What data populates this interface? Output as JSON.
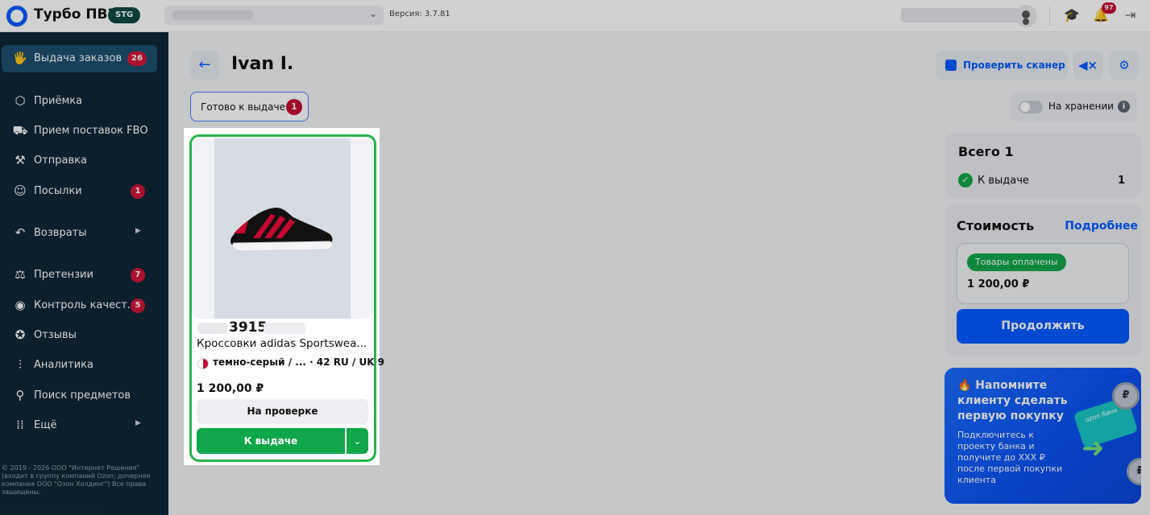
{
  "app": {
    "title": "Турбо ПВЗ",
    "env_badge": "STG",
    "version": "Версия: 3.7.81"
  },
  "topbar": {
    "notifications_count": "97"
  },
  "sidebar": {
    "items": [
      {
        "label": "Выдача заказов",
        "icon": "box-hand-icon",
        "count": "26"
      },
      {
        "label": "Приёмка",
        "icon": "package-icon"
      },
      {
        "label": "Прием поставок FBO",
        "icon": "truck-icon"
      },
      {
        "label": "Отправка",
        "icon": "dolly-icon"
      },
      {
        "label": "Посылки",
        "icon": "person-icon",
        "count": "1"
      },
      {
        "label": "Возвраты",
        "icon": "return-icon"
      },
      {
        "label": "Претензии",
        "icon": "gavel-icon",
        "count": "7"
      },
      {
        "label": "Контроль качест...",
        "icon": "eye-icon",
        "count": "5"
      },
      {
        "label": "Отзывы",
        "icon": "chat-star-icon"
      },
      {
        "label": "Аналитика",
        "icon": "analytics-icon"
      },
      {
        "label": "Поиск предметов",
        "icon": "search-icon"
      },
      {
        "label": "Ещё",
        "icon": "dots-grid-icon"
      }
    ],
    "copyright": "© 2019 - 2026 ООО \"Интернет Решения\" (входит в группу компаний Ozon; дочерняя компания ООО \"Озон Холдинг\") Все права защищены."
  },
  "main": {
    "customer_name": "Ivan I.",
    "check_scanner_label": "Проверить сканер",
    "status_chip": {
      "label": "Готово к выдаче",
      "count": "1"
    },
    "storage_toggle_label": "На хранении",
    "storage_toggle_on": false
  },
  "product": {
    "article": "3915",
    "name": "Кроссовки adidas Sportswea...",
    "variant": "темно-серый / ... · 42 RU / UK 9",
    "price": "1 200,00 ₽",
    "status_button": "На проверке",
    "issue_button": "К выдаче"
  },
  "summary": {
    "title": "Всего  1",
    "row_label": "К выдаче",
    "row_count": "1"
  },
  "cost": {
    "title": "Стоимость",
    "details_link": "Подробнее",
    "paid_badge": "Товары оплачены",
    "amount": "1 200,00 ₽",
    "continue_button": "Продолжить"
  },
  "promo": {
    "title": "🔥 Напомните клиенту сделать первую покупку",
    "text": "Подключитесь к проекту банка и получите до XXX ₽ после первой покупки клиента",
    "card_label": "ozon банк",
    "coin_symbol": "₽"
  },
  "colors": {
    "brand_blue": "#005bff",
    "sidebar_bg": "#0f2738",
    "success_green": "#10a64a",
    "badge_red": "#c5082f"
  }
}
